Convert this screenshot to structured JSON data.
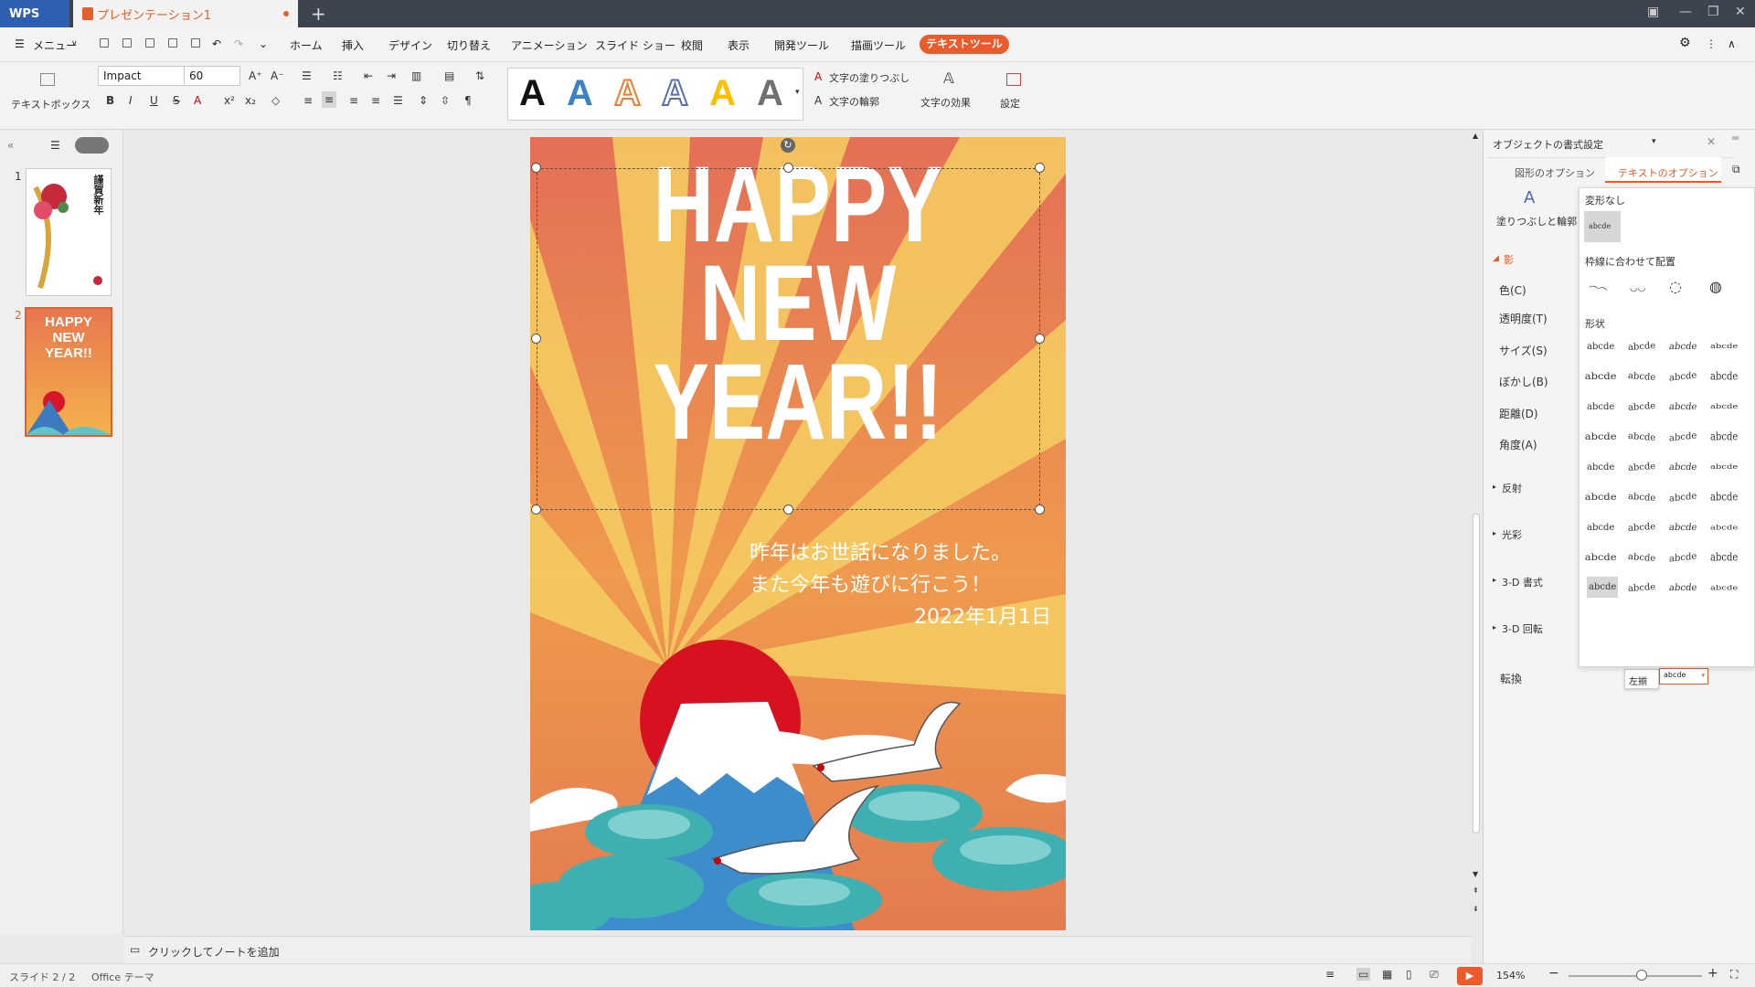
{
  "titlebar": {
    "app": "WPS",
    "doc_title": "プレゼンテーション1",
    "new_tab": "+"
  },
  "menu": {
    "menu_label": "メニュー",
    "items": [
      "ホーム",
      "挿入",
      "デザイン",
      "切り替え",
      "アニメーション",
      "スライド ショー",
      "校閲",
      "表示",
      "開発ツール",
      "描画ツール"
    ],
    "active": "テキストツール"
  },
  "ribbon": {
    "textbox_label": "テキストボックス",
    "font_name": "Impact",
    "font_size": "60",
    "bold": "B",
    "italic": "I",
    "underline": "U",
    "strike": "S",
    "fill_label": "文字の塗りつぶし",
    "outline_label": "文字の輪郭",
    "effect_label": "文字の効果",
    "settings_label": "設定",
    "gallery": [
      {
        "glyph": "A",
        "color": "#111111"
      },
      {
        "glyph": "A",
        "color": "#3b82c4"
      },
      {
        "glyph": "A",
        "color": "#ed7d31"
      },
      {
        "glyph": "A",
        "color": "#5b6fae"
      },
      {
        "glyph": "A",
        "color": "#ffc000"
      },
      {
        "glyph": "A",
        "color": "#707070"
      }
    ]
  },
  "thumbnails": [
    {
      "num": "1",
      "title": "謹賀新年"
    },
    {
      "num": "2",
      "title": "HAPPY NEW YEAR!!"
    }
  ],
  "slide": {
    "headline": [
      "HAPPY",
      "NEW",
      "YEAR!!"
    ],
    "message": [
      "昨年はお世話になりました。",
      "また今年も遊びに行こう！",
      "2022年1月1日"
    ]
  },
  "notes": {
    "placeholder": "クリックしてノートを追加"
  },
  "status": {
    "slide": "スライド 2 / 2",
    "theme": "Office テーマ",
    "zoom": "154%"
  },
  "panel": {
    "title": "オブジェクトの書式設定",
    "tabs": [
      "図形のオプション",
      "テキストのオプション"
    ],
    "fill_outline": "塗りつぶしと輪郭",
    "shadow": "影",
    "props": [
      "色(C)",
      "透明度(T)",
      "サイズ(S)",
      "ぼかし(B)",
      "距離(D)",
      "角度(A)"
    ],
    "sections": [
      "反射",
      "光彩",
      "3-D 書式",
      "3-D 回転"
    ],
    "transform": "転換",
    "transform_value": "abcde",
    "tooltip": "左揃"
  },
  "warp_popup": {
    "no_transform": "変形なし",
    "follow_path": "枠線に合わせて配置",
    "shape": "形状",
    "sample": "abcde"
  },
  "colors": {
    "accent": "#ea5a2a",
    "wps_blue": "#2f5fb0",
    "titlebar": "#3e4350"
  }
}
